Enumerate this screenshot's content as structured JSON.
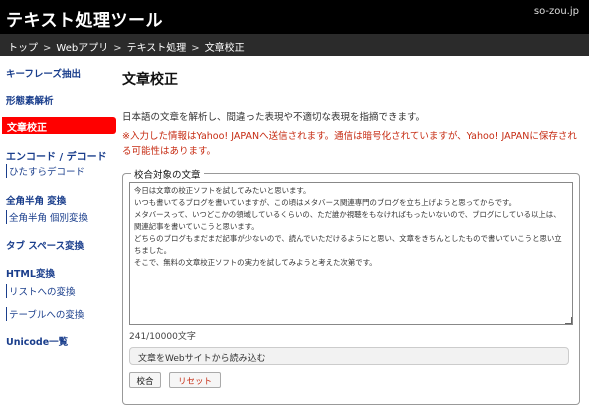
{
  "header": {
    "app_title": "テキスト処理ツール",
    "domain": "so-zou.jp"
  },
  "breadcrumb": {
    "items": [
      "トップ",
      "Webアプリ",
      "テキスト処理",
      "文章校正"
    ],
    "separator": ">"
  },
  "sidebar": {
    "keyphrase": "キーフレーズ抽出",
    "morph": "形態素解析",
    "active": "文章校正",
    "encode_heading": "エンコード / デコード",
    "hiragana": "ひたすらデコード",
    "zenkaku_heading": "全角半角 変換",
    "zenkaku_sub": "全角半角 個別変換",
    "tab_space": "タブ スペース変換",
    "html_heading": "HTML変換",
    "list_conv": "リストへの変換",
    "table_conv": "テーブルへの変換",
    "unicode": "Unicode一覧"
  },
  "main": {
    "title": "文章校正",
    "description": "日本語の文章を解析し、間違った表現や不適切な表現を指摘できます。",
    "warning": "※入力した情報はYahoo! JAPANへ送信されます。通信は暗号化されていますが、Yahoo! JAPANに保存される可能性はあります。",
    "fieldset_legend": "校合対象の文章",
    "textarea_value": "今日は文章の校正ソフトを試してみたいと思います。\nいつも書いてるブログを書いていますが、この頃はメタバース関連専門のブログを立ち上げようと思ってからです。\nメタバースって、いつどこかの領域しているくらいの、ただ誰か視聴をもなければもったいないので、ブログにしている以上は、\n関連記事を書いていこうと思います。\nどちらのブログもまだまだ記事が少ないので、読んでいただけるようにと思い、文章をきちんとしたもので書いていこうと思い立ちました。\nそこで、無料の文章校正ソフトの実力を試してみようと考えた次第です。",
    "char_count": "241/10000文字",
    "load_button": "文章をWebサイトから読み込む",
    "submit_button": "校合",
    "reset_button": "リセット"
  },
  "colors": {
    "header_bg": "#000000",
    "breadcrumb_bg": "#2b2b2b",
    "active_nav": "#ff0000",
    "link": "#1a3e8c",
    "warning": "#c62b12"
  }
}
